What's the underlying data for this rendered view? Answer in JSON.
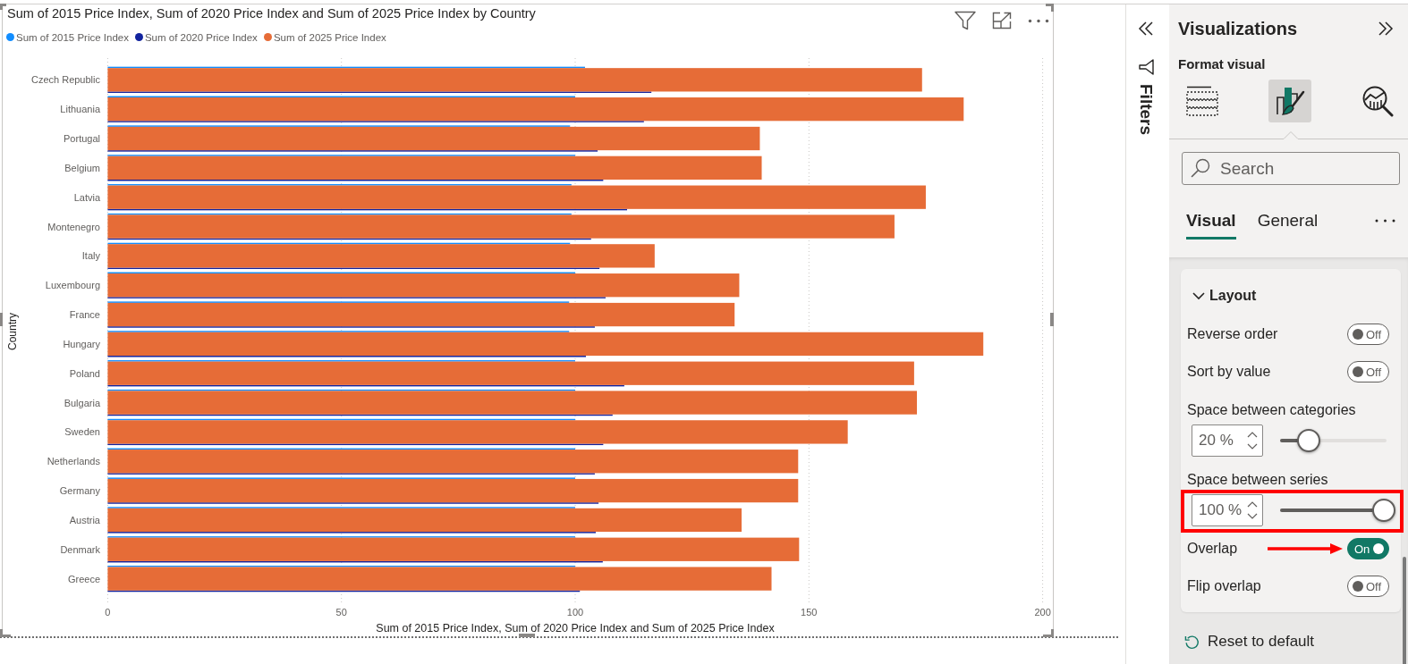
{
  "visual": {
    "chart_data": {
      "type": "bar",
      "orientation": "horizontal",
      "title": "Sum of 2015 Price Index, Sum of 2020 Price Index and Sum of 2025 Price Index by Country",
      "xlabel": "Sum of 2015 Price Index, Sum of 2020 Price Index and Sum of 2025 Price Index",
      "ylabel": "Country",
      "categories": [
        "Czech Republic",
        "Lithuania",
        "Portugal",
        "Belgium",
        "Latvia",
        "Montenegro",
        "Italy",
        "Luxembourg",
        "France",
        "Hungary",
        "Poland",
        "Bulgaria",
        "Sweden",
        "Netherlands",
        "Germany",
        "Austria",
        "Denmark",
        "Greece"
      ],
      "series": [
        {
          "name": "Sum of 2015 Price Index",
          "color": "#118dff",
          "values": [
            102.1,
            100,
            98.9,
            100,
            99.2,
            99.2,
            98.9,
            100,
            98.7,
            98.7,
            100,
            100,
            100,
            100,
            100,
            100,
            100,
            100
          ]
        },
        {
          "name": "Sum of 2020 Price Index",
          "color": "#12239e",
          "values": [
            116.3,
            114.7,
            104.8,
            106,
            111.1,
            103.4,
            105.2,
            106.5,
            104.2,
            102.3,
            110.5,
            108,
            106,
            104.2,
            105,
            104.4,
            105.9,
            101
          ]
        },
        {
          "name": "Sum of 2025 Price Index",
          "color": "#e66c37",
          "values": [
            174.2,
            183.1,
            139.5,
            139.9,
            175,
            168.3,
            117,
            135.1,
            134.1,
            187.3,
            172.5,
            173.1,
            158.3,
            147.7,
            147.7,
            135.6,
            147.9,
            142
          ]
        }
      ],
      "xlim": [
        0,
        200
      ],
      "xticks": [
        0,
        50,
        100,
        150,
        200
      ],
      "grid": true
    }
  },
  "filters_pane": {
    "title": "Filters"
  },
  "visualizations_pane": {
    "title": "Visualizations",
    "subtitle": "Format visual",
    "modes": [
      {
        "kind": "build",
        "selected": false
      },
      {
        "kind": "format",
        "selected": true
      },
      {
        "kind": "analytics",
        "selected": false
      }
    ],
    "search": {
      "placeholder": "Search"
    },
    "tabs": [
      {
        "label": "Visual",
        "selected": true
      },
      {
        "label": "General",
        "selected": false
      }
    ],
    "card": {
      "title": "Layout",
      "expanded": true,
      "settings": [
        {
          "kind": "toggle",
          "label": "Reverse order",
          "on": false,
          "state_text": "Off",
          "pointed_at": false
        },
        {
          "kind": "toggle",
          "label": "Sort by value",
          "on": false,
          "state_text": "Off",
          "pointed_at": false
        },
        {
          "kind": "slider",
          "label": "Space between categories",
          "value": "20 %",
          "level": 0.2,
          "highlighted": false
        },
        {
          "kind": "slider",
          "label": "Space between series",
          "value": "100 %",
          "level": 1,
          "highlighted": true
        },
        {
          "kind": "toggle",
          "label": "Overlap",
          "on": true,
          "state_text": "On",
          "pointed_at": true
        },
        {
          "kind": "toggle",
          "label": "Flip overlap",
          "on": false,
          "state_text": "Off",
          "pointed_at": false
        }
      ]
    },
    "reset": "Reset to default"
  }
}
